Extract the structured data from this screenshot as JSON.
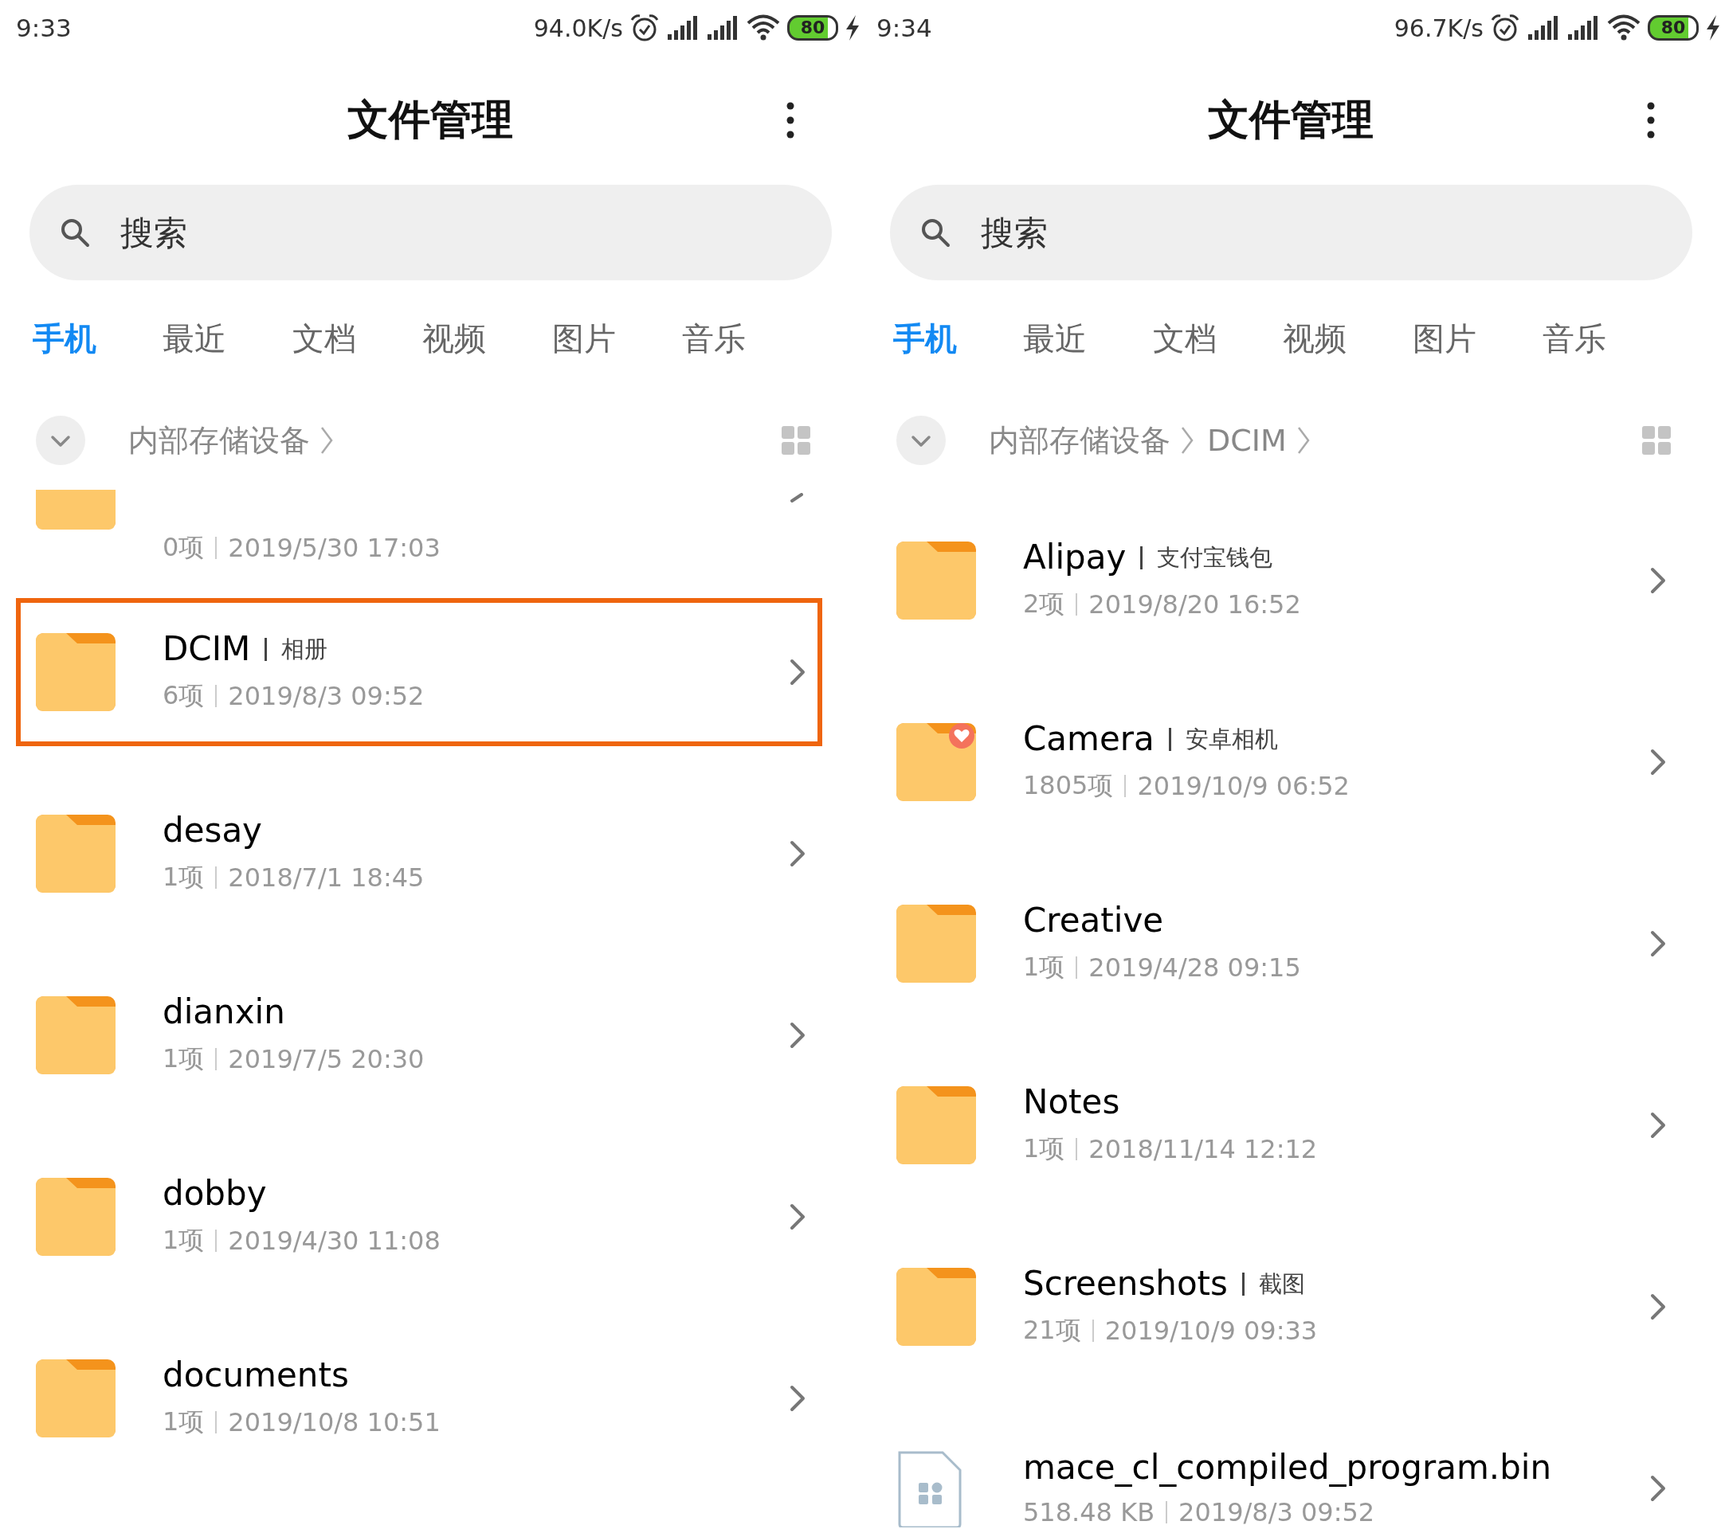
{
  "screens": [
    {
      "status_bar": {
        "time": "9:33",
        "net_speed": "94.0K/s",
        "battery": "80"
      },
      "title": "文件管理",
      "search": {
        "placeholder": "搜索"
      },
      "tabs": [
        {
          "label": "手机",
          "selected": true
        },
        {
          "label": "最近",
          "selected": false
        },
        {
          "label": "文档",
          "selected": false
        },
        {
          "label": "视频",
          "selected": false
        },
        {
          "label": "图片",
          "selected": false
        },
        {
          "label": "音乐",
          "selected": false
        }
      ],
      "breadcrumb": [
        "内部存储设备"
      ],
      "items": [
        {
          "kind": "partial-folder",
          "count": "0项",
          "date": "2019/5/30 17:03",
          "highlighted": false
        },
        {
          "kind": "folder",
          "name": "DCIM",
          "subtitle": "相册",
          "count": "6项",
          "date": "2019/8/3 09:52",
          "highlighted": true
        },
        {
          "kind": "folder",
          "name": "desay",
          "count": "1项",
          "date": "2018/7/1 18:45",
          "highlighted": false
        },
        {
          "kind": "folder",
          "name": "dianxin",
          "count": "1项",
          "date": "2019/7/5 20:30",
          "highlighted": false
        },
        {
          "kind": "folder",
          "name": "dobby",
          "count": "1项",
          "date": "2019/4/30 11:08",
          "highlighted": false
        },
        {
          "kind": "folder",
          "name": "documents",
          "count": "1项",
          "date": "2019/10/8 10:51",
          "highlighted": false
        }
      ]
    },
    {
      "status_bar": {
        "time": "9:34",
        "net_speed": "96.7K/s",
        "battery": "80"
      },
      "title": "文件管理",
      "search": {
        "placeholder": "搜索"
      },
      "tabs": [
        {
          "label": "手机",
          "selected": true
        },
        {
          "label": "最近",
          "selected": false
        },
        {
          "label": "文档",
          "selected": false
        },
        {
          "label": "视频",
          "selected": false
        },
        {
          "label": "图片",
          "selected": false
        },
        {
          "label": "音乐",
          "selected": false
        }
      ],
      "breadcrumb": [
        "内部存储设备",
        "DCIM"
      ],
      "items": [
        {
          "kind": "folder",
          "name": "Alipay",
          "subtitle": "支付宝钱包",
          "count": "2项",
          "date": "2019/8/20 16:52",
          "highlighted": false
        },
        {
          "kind": "favorite-folder",
          "name": "Camera",
          "subtitle": "安卓相机",
          "count": "1805项",
          "date": "2019/10/9 06:52",
          "highlighted": false
        },
        {
          "kind": "folder",
          "name": "Creative",
          "count": "1项",
          "date": "2019/4/28 09:15",
          "highlighted": false
        },
        {
          "kind": "folder",
          "name": "Notes",
          "count": "1项",
          "date": "2018/11/14 12:12",
          "highlighted": false
        },
        {
          "kind": "folder",
          "name": "Screenshots",
          "subtitle": "截图",
          "count": "21项",
          "date": "2019/10/9 09:33",
          "highlighted": false
        },
        {
          "kind": "file",
          "name": "mace_cl_compiled_program.bin",
          "count": "518.48 KB",
          "date": "2019/8/3 09:52",
          "highlighted": false
        }
      ]
    }
  ]
}
